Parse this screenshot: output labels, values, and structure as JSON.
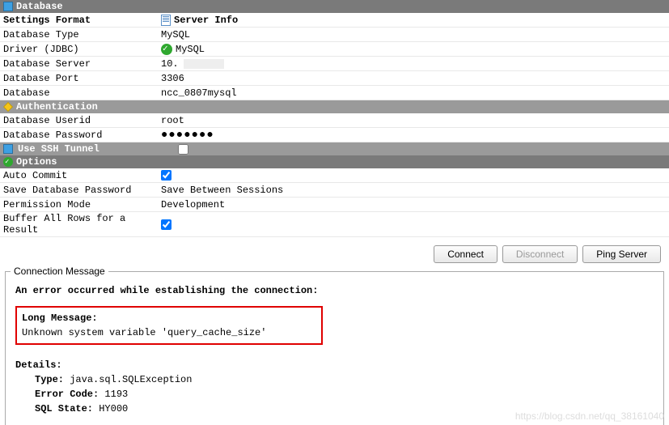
{
  "sections": {
    "database": "Database",
    "auth": "Authentication",
    "ssh": "Use SSH Tunnel",
    "options": "Options"
  },
  "db": {
    "settingsFormatLabel": "Settings Format",
    "settingsFormatValue": "Server Info",
    "typeLabel": "Database Type",
    "typeValue": "MySQL",
    "driverLabel": "Driver (JDBC)",
    "driverValue": "MySQL",
    "serverLabel": "Database Server",
    "serverValue": "10.",
    "portLabel": "Database Port",
    "portValue": "3306",
    "nameLabel": "Database",
    "nameValue": "ncc_0807mysql"
  },
  "auth": {
    "userLabel": "Database Userid",
    "userValue": "root",
    "passLabel": "Database Password",
    "passValue": "●●●●●●●"
  },
  "options": {
    "autoCommitLabel": "Auto Commit",
    "autoCommitChecked": true,
    "savePwdLabel": "Save Database Password",
    "savePwdValue": "Save Between Sessions",
    "permLabel": "Permission Mode",
    "permValue": "Development",
    "bufferLabel": "Buffer All Rows for a Result",
    "bufferChecked": true
  },
  "ssh": {
    "checked": false
  },
  "buttons": {
    "connect": "Connect",
    "disconnect": "Disconnect",
    "ping": "Ping Server"
  },
  "msg": {
    "fieldsetTitle": "Connection Message",
    "errorLine": "An error occurred while establishing the connection:",
    "longMsgLabel": "Long Message:",
    "longMsgValue": "Unknown system variable 'query_cache_size'",
    "detailsLabel": "Details:",
    "typeLabel": "Type:",
    "typeValue": "java.sql.SQLException",
    "errCodeLabel": "Error Code:",
    "errCodeValue": "1193",
    "sqlStateLabel": "SQL State:",
    "sqlStateValue": "HY000"
  },
  "watermark": "https://blog.csdn.net/qq_38161040"
}
